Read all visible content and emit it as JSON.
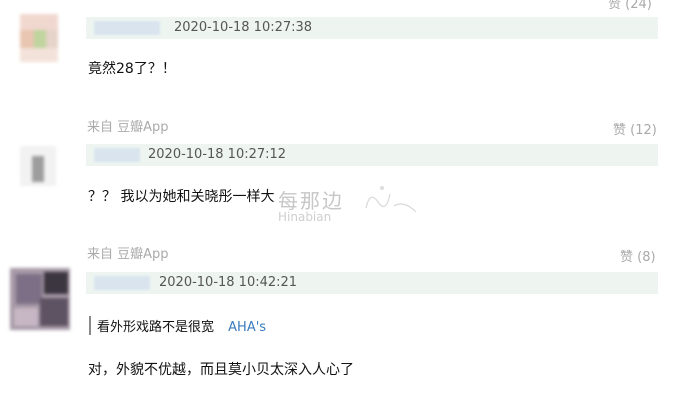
{
  "comments": [
    {
      "source": "",
      "likes": "赞 (24)",
      "time": "2020-10-18 10:27:38",
      "text": "竟然28了？！"
    },
    {
      "source": "来自 豆瓣App",
      "likes": "赞 (12)",
      "time": "2020-10-18 10:27:12",
      "text": "？？ 我以为她和关晓彤一样大"
    },
    {
      "source": "来自 豆瓣App",
      "likes": "赞 (8)",
      "time": "2020-10-18 10:42:21",
      "quote_text": "看外形戏路不是很宽",
      "quote_user": "AHA's",
      "text": "对，外貌不优越，而且莫小贝太深入人心了"
    }
  ],
  "watermark": {
    "cn": "每那边",
    "en": "Hinabian"
  },
  "colors": {
    "meta_bg": "#eef5f1",
    "link": "#3a7bbd",
    "muted": "#aaaaaa"
  }
}
